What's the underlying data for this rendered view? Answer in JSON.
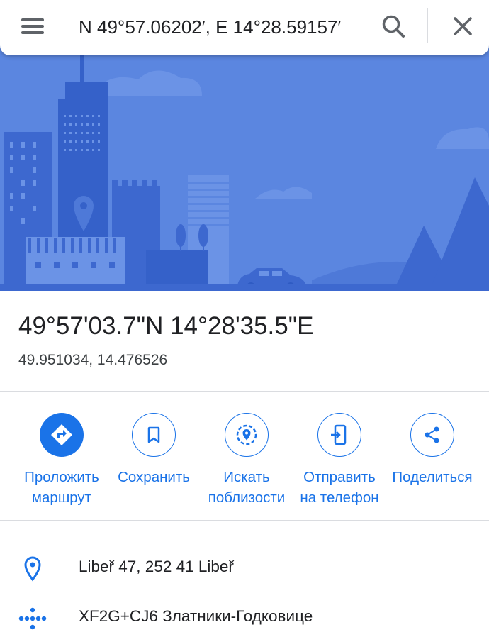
{
  "search": {
    "query": "N 49°57.06202′, E 14°28.59157′",
    "menu_icon": "hamburger-menu-icon",
    "search_icon": "search-icon",
    "close_icon": "close-icon"
  },
  "place": {
    "title": "49°57'03.7\"N 14°28'35.5\"E",
    "decimal": "49.951034, 14.476526"
  },
  "actions": [
    {
      "label_line1": "Проложить",
      "label_line2": "маршрут",
      "icon": "directions-icon"
    },
    {
      "label_line1": "Сохранить",
      "label_line2": "",
      "icon": "bookmark-icon"
    },
    {
      "label_line1": "Искать",
      "label_line2": "поблизости",
      "icon": "nearby-search-icon"
    },
    {
      "label_line1": "Отправить",
      "label_line2": "на телефон",
      "icon": "send-to-phone-icon"
    },
    {
      "label_line1": "Поделиться",
      "label_line2": "",
      "icon": "share-icon"
    }
  ],
  "details": [
    {
      "text": "Libeř 47, 252 41 Libeř",
      "icon": "location-pin-icon"
    },
    {
      "text": "XF2G+CJ6 Златники-Годковице",
      "icon": "plus-code-icon"
    }
  ],
  "colors": {
    "accent": "#1a73e8",
    "hero_bg": "#5b86e0",
    "text_primary": "#202124",
    "text_secondary": "#3c4043",
    "divider": "#dadce0"
  }
}
